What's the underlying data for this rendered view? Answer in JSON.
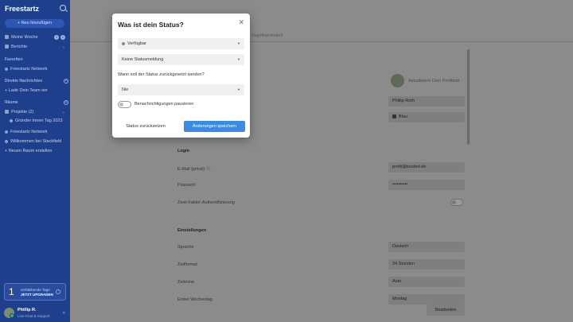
{
  "sidebar": {
    "logo": "Freestartz",
    "new_button": "+ Neu hinzufügen",
    "nav": [
      {
        "label": "Meine Woche",
        "badges": [
          "4",
          "4"
        ]
      },
      {
        "label": "Berichte"
      }
    ],
    "favorites_header": "Favoriten",
    "favorites": [
      {
        "label": "Freestartz Network"
      }
    ],
    "direct_header": "Direkte Nachrichten",
    "direct": [
      {
        "label": "+ Lade Dein Team ein"
      }
    ],
    "spaces_header": "Räume",
    "spaces": [
      {
        "label": "Projekte (2)"
      },
      {
        "label": "Gründer Innen Tag 2023"
      },
      {
        "label": "Freestartz Network"
      },
      {
        "label": "Willkommen bei Stackfield"
      },
      {
        "label": "+ Neuen Raum erstellen"
      }
    ],
    "trial": {
      "number": "1",
      "line1": "verbleibende Tage",
      "line2": "JETZT UPGRADEN"
    },
    "user": {
      "name": "Phillip R.",
      "subtitle": "Live-Chat & Support"
    }
  },
  "main": {
    "tab": "Zugriffsprotokoll",
    "profile_picture_label": "Aktualisiere Dein Profilbild",
    "fields_top": [
      {
        "value": "Phillip Roth"
      },
      {
        "value": "Blau",
        "color": "#333333"
      }
    ],
    "login": {
      "header": "Login",
      "email_label": "E-Mail (privat)",
      "email_value": "pretti@trusted.de",
      "password_label": "Passwort",
      "password_value": "••••••••••",
      "twofa_label": "Zwei-Faktor-Authentifizierung"
    },
    "settings": {
      "header": "Einstellungen",
      "rows": [
        {
          "label": "Sprache",
          "value": "Deutsch"
        },
        {
          "label": "Zeitformat",
          "value": "24 Stunden"
        },
        {
          "label": "Zeitzone",
          "value": "Auto"
        },
        {
          "label": "Erster Wochentag",
          "value": "Montag"
        }
      ]
    },
    "edit_button": "Bearbeiten"
  },
  "modal": {
    "title": "Was ist dein Status?",
    "close_icon": "close-icon",
    "availability": "Verfügbar",
    "status_message": "Keine Statusmeldung",
    "reset_question": "Wann soll der Status zurückgesetzt werden?",
    "reset_value": "Nie",
    "pause_notifications": "Benachrichtigungen pausieren",
    "reset_button": "Status zurücksetzen",
    "save_button": "Änderungen speichern"
  },
  "colors": {
    "sidebar": "#1d3f8c",
    "primary": "#3d8be0"
  }
}
